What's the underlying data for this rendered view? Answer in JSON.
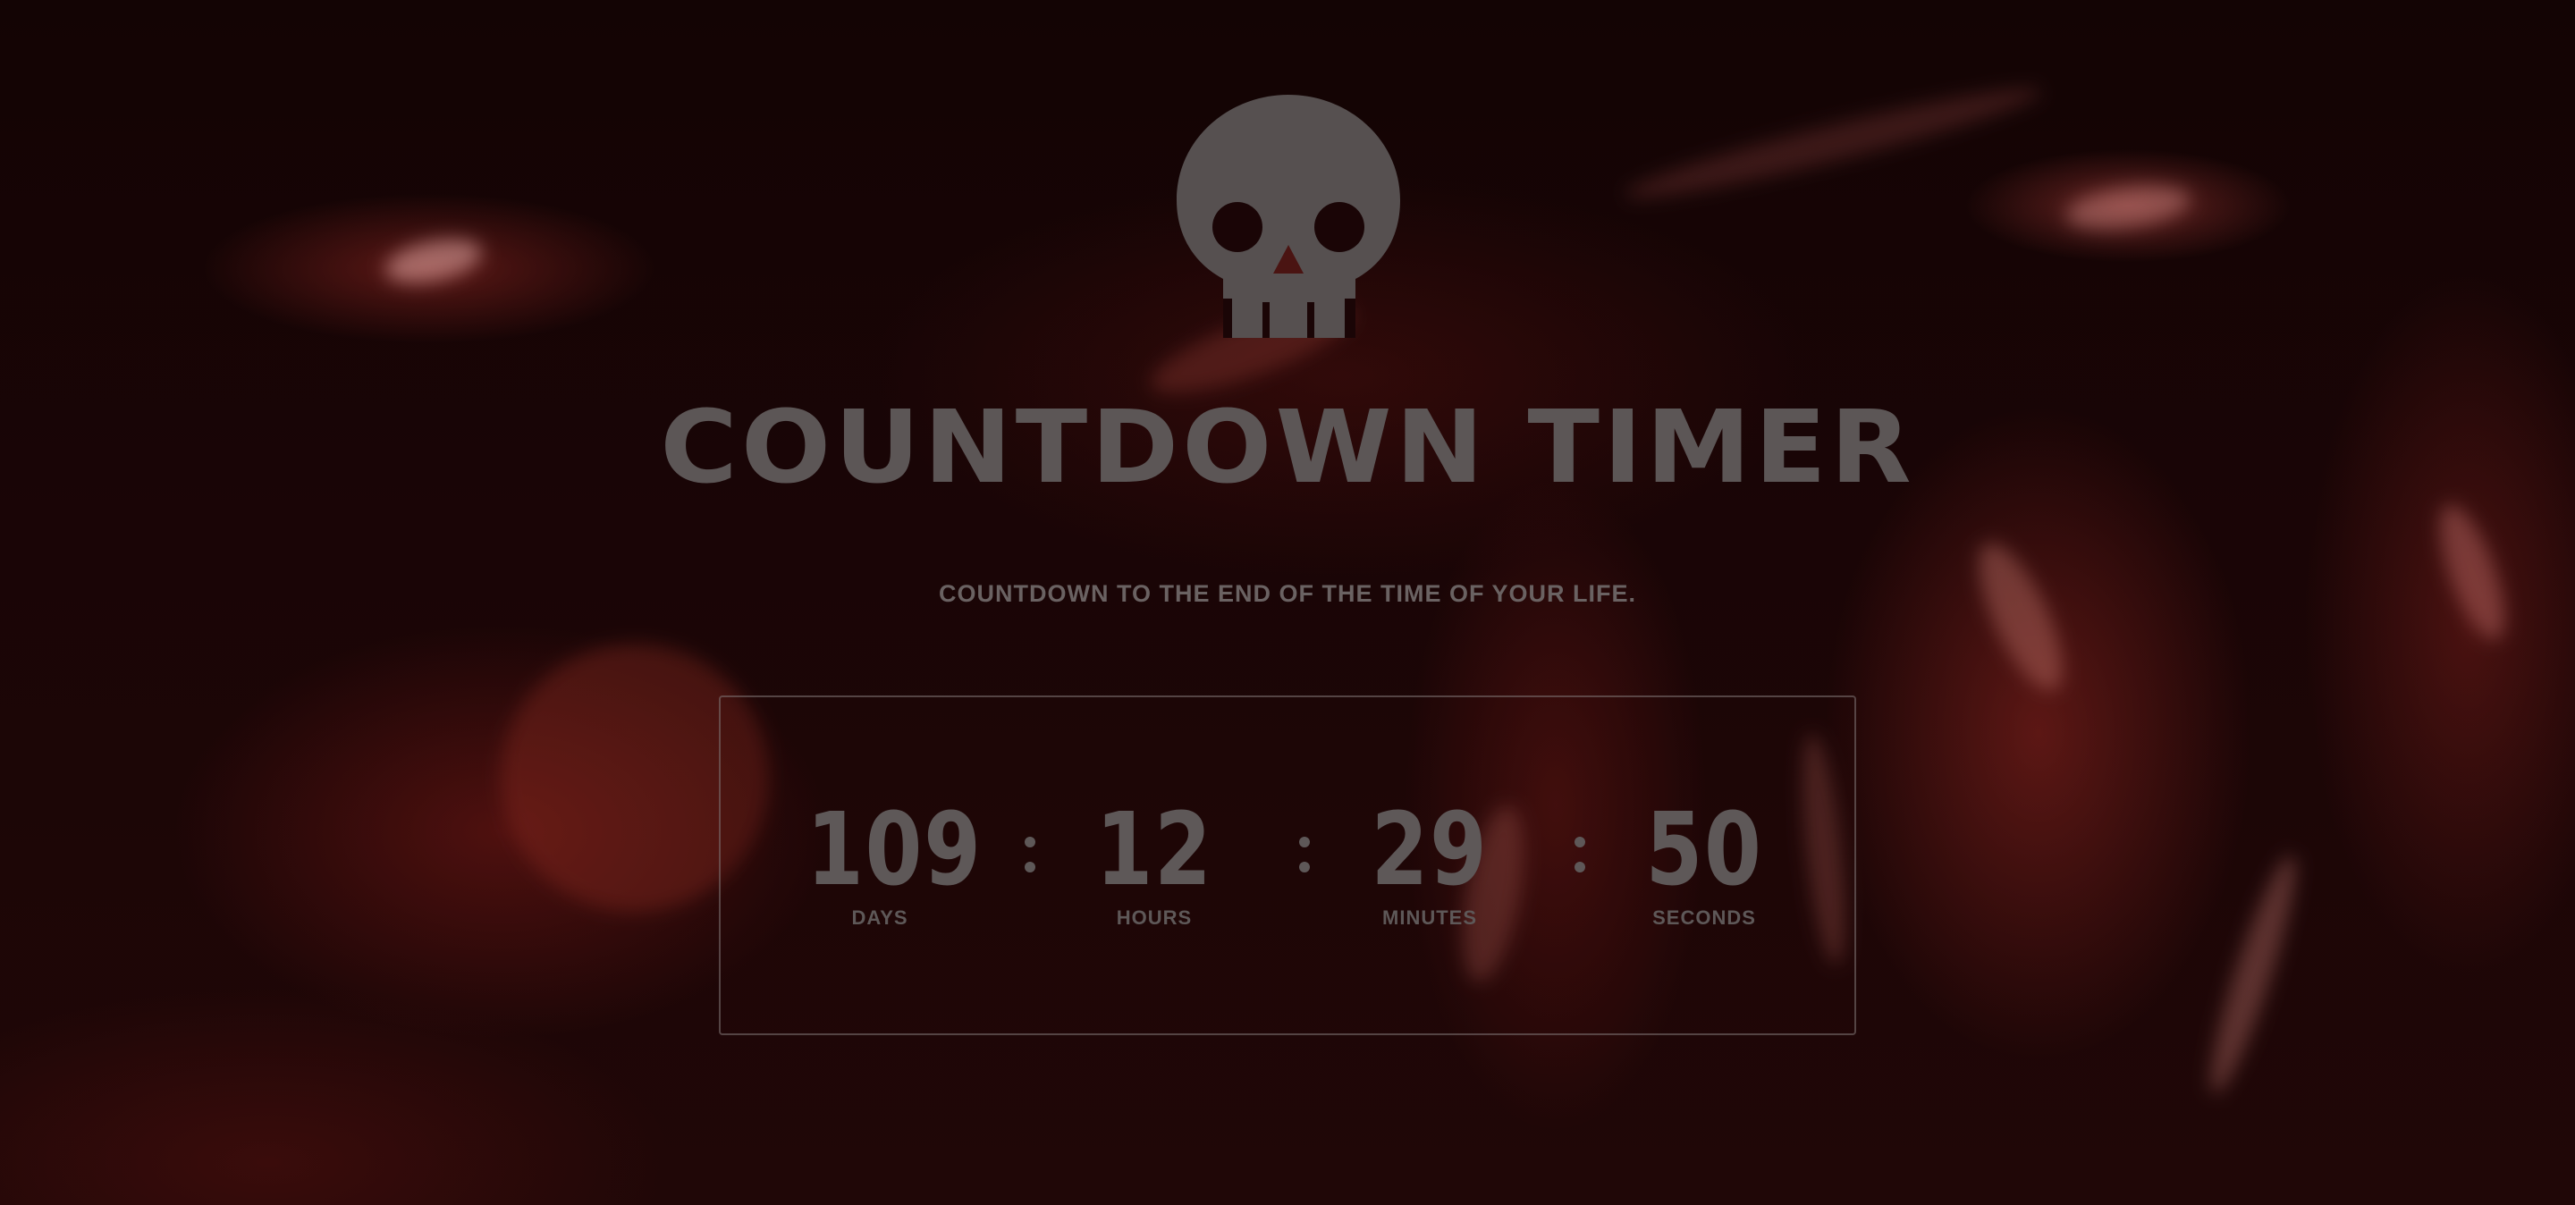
{
  "app": {
    "title": "COUNTDOWN TIMER",
    "subtitle": "COUNTDOWN TO THE END OF THE TIME OF YOUR LIFE."
  },
  "logo": {
    "icon": "skull-icon"
  },
  "timer": {
    "separator": ":",
    "units": [
      {
        "value": "109",
        "label": "DAYS"
      },
      {
        "value": "12",
        "label": "HOURS"
      },
      {
        "value": "29",
        "label": "MINUTES"
      },
      {
        "value": "50",
        "label": "SECONDS"
      }
    ]
  },
  "colors": {
    "text": "#5e5858",
    "background": "#1a0506",
    "accent": "#8a2620"
  }
}
